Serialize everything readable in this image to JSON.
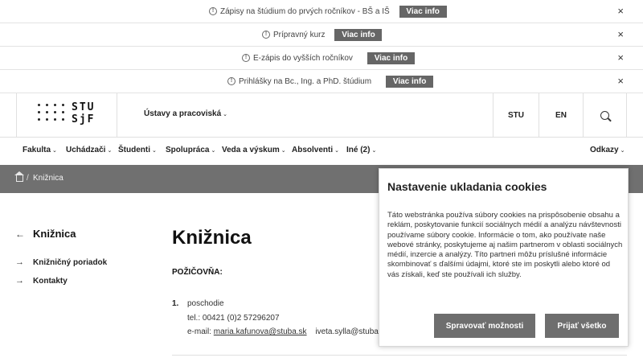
{
  "notices": [
    {
      "text": "Zápisy na štúdium do prvých ročníkov - BŠ a IŠ",
      "button": "Viac info"
    },
    {
      "text": "Prípravný kurz",
      "button": "Viac info"
    },
    {
      "text": "E-zápis do vyšších ročníkov",
      "button": "Viac info"
    },
    {
      "text": "Prihlášky na Bc., Ing. a PhD. štúdium",
      "button": "Viac info"
    }
  ],
  "close_glyph": "×",
  "info_glyph": "!",
  "header": {
    "logo_line1": "STU",
    "logo_line2": "SjF",
    "ustavy": "Ústavy a pracoviská",
    "stu": "STU",
    "lang": "EN"
  },
  "caret": "⌄",
  "nav": {
    "items": [
      "Fakulta",
      "Uchádzači",
      "Študenti",
      "Spolupráca",
      "Veda a výskum",
      "Absolventi",
      "Iné (2)"
    ],
    "right": "Odkazy"
  },
  "breadcrumb": {
    "separator": "/",
    "current": "Knižnica"
  },
  "sidebar": {
    "back_arrow": "←",
    "title": "Knižnica",
    "item_arrow": "→",
    "items": [
      "Knižničný poriadok",
      "Kontakty"
    ]
  },
  "content": {
    "title": "Knižnica",
    "subhead": "POŽIČOVŇA:",
    "list_number": "1.",
    "line1": "poschodie",
    "line2": "tel.: 00421 (0)2 57296207",
    "email_label": "e-mail:",
    "email1": "maria.kafunova@stuba.sk",
    "email2": "iveta.sylla@stuba.sk"
  },
  "cookie": {
    "title": "Nastavenie ukladania cookies",
    "text": "Táto webstránka používa súbory cookies na prispôsobenie obsahu a reklám, poskytovanie funkcií sociálnych médií a analýzu návštevnosti používame súbory cookie. Informácie o tom, ako používate naše webové stránky, poskytujeme aj našim partnerom v oblasti sociálnych médií, inzercie a analýzy. Títo partneri môžu príslušné informácie skombinovať s ďalšími údajmi, ktoré ste im poskytli alebo ktoré od vás získali, keď ste používali ich služby.",
    "manage_button": "Spravovať možnosti",
    "accept_button": "Prijať všetko"
  }
}
